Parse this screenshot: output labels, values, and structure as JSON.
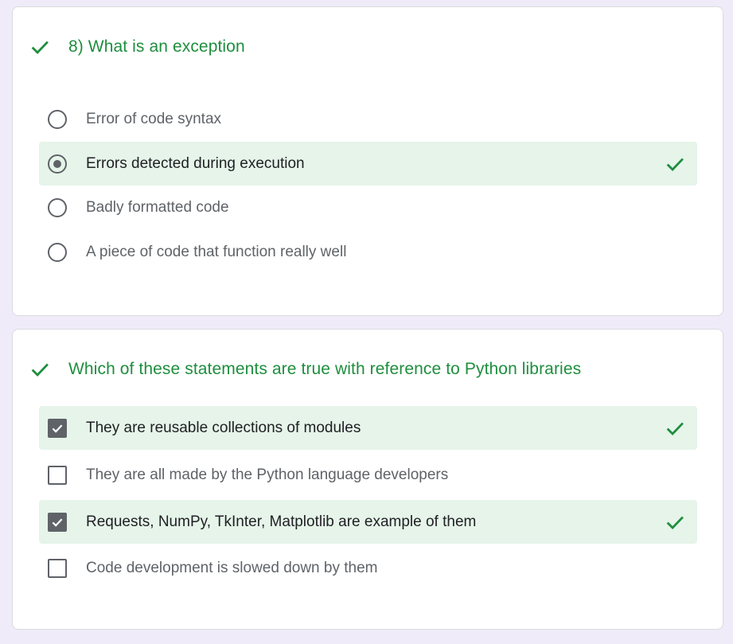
{
  "colors": {
    "page_background": "#efebf9",
    "correct_green": "#1e8e3e",
    "correct_row_background": "#e6f4ea",
    "control_gray": "#5f6368"
  },
  "questions": [
    {
      "title": "8) What is an exception",
      "status_icon": "checkmark-icon",
      "type": "radio",
      "options": [
        {
          "label": "Error of code syntax",
          "selected": false,
          "marked_correct": false
        },
        {
          "label": "Errors detected during execution",
          "selected": true,
          "marked_correct": true
        },
        {
          "label": "Badly formatted code",
          "selected": false,
          "marked_correct": false
        },
        {
          "label": "A piece of code that function really well",
          "selected": false,
          "marked_correct": false
        }
      ]
    },
    {
      "title": "Which of these statements are true with reference to Python libraries",
      "status_icon": "checkmark-icon",
      "type": "checkbox",
      "options": [
        {
          "label": "They are reusable collections of modules",
          "checked": true,
          "marked_correct": true
        },
        {
          "label": "They are all made by the Python language developers",
          "checked": false,
          "marked_correct": false
        },
        {
          "label": "Requests, NumPy, TkInter, Matplotlib are example of them",
          "checked": true,
          "marked_correct": true
        },
        {
          "label": "Code development is slowed down by them",
          "checked": false,
          "marked_correct": false
        }
      ]
    }
  ]
}
